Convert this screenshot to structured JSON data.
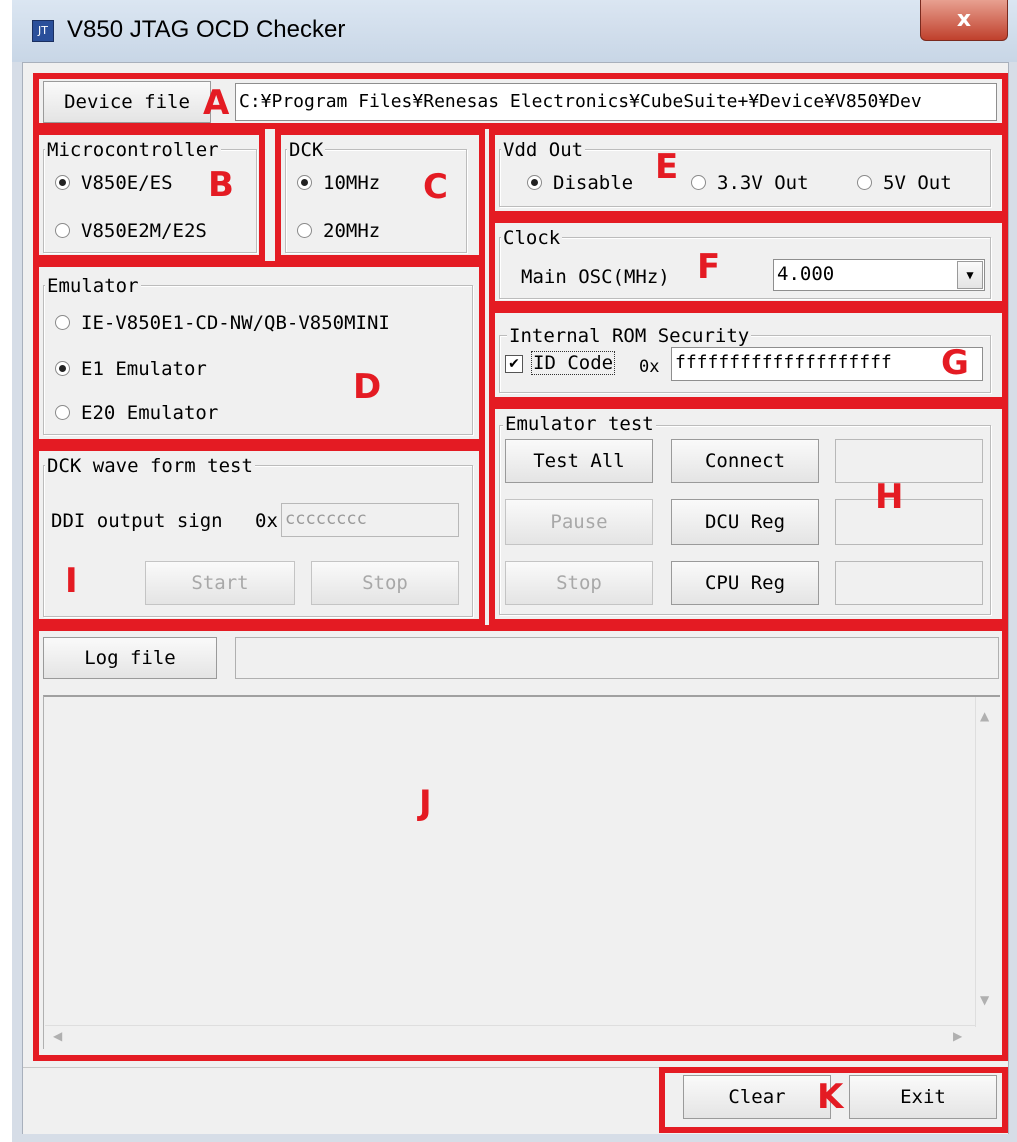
{
  "window": {
    "title": "V850 JTAG OCD Checker",
    "close_glyph": "x",
    "icon_glyph": "JT"
  },
  "device_file": {
    "label": "Device file",
    "path": "C:¥Program Files¥Renesas Electronics¥CubeSuite+¥Device¥V850¥Dev"
  },
  "microcontroller": {
    "legend": "Microcontroller",
    "options": [
      "V850E/ES",
      "V850E2M/E2S"
    ],
    "selected": "V850E/ES"
  },
  "dck": {
    "legend": "DCK",
    "options": [
      "10MHz",
      "20MHz"
    ],
    "selected": "10MHz"
  },
  "vdd_out": {
    "legend": "Vdd Out",
    "options": [
      "Disable",
      "3.3V Out",
      "5V Out"
    ],
    "selected": "Disable"
  },
  "clock": {
    "legend": "Clock",
    "label": "Main OSC(MHz)",
    "value": "4.000"
  },
  "emulator": {
    "legend": "Emulator",
    "options": [
      "IE-V850E1-CD-NW/QB-V850MINI",
      "E1 Emulator",
      "E20 Emulator"
    ],
    "selected": "E1 Emulator"
  },
  "rom_security": {
    "legend": "Internal ROM Security",
    "checkbox_label": "ID Code",
    "checked": true,
    "prefix": "0x",
    "value": "ffffffffffffffffffff"
  },
  "emulator_test": {
    "legend": "Emulator test",
    "test_all": "Test All",
    "connect": "Connect",
    "pause": "Pause",
    "dcu_reg": "DCU Reg",
    "stop": "Stop",
    "cpu_reg": "CPU Reg"
  },
  "dck_wave": {
    "legend": "DCK wave form test",
    "label": "DDI output sign",
    "prefix": "0x",
    "value": "cccccccc",
    "start": "Start",
    "stop": "Stop"
  },
  "log": {
    "button": "Log file",
    "path": ""
  },
  "footer": {
    "clear": "Clear",
    "exit": "Exit"
  },
  "annotations": {
    "A": "A",
    "B": "B",
    "C": "C",
    "D": "D",
    "E": "E",
    "F": "F",
    "G": "G",
    "H": "H",
    "I": "I",
    "J": "J",
    "K": "K"
  },
  "colors": {
    "annotation": "#e41b23",
    "titlebar": "#c8d6e6",
    "close": "#c0402c"
  }
}
